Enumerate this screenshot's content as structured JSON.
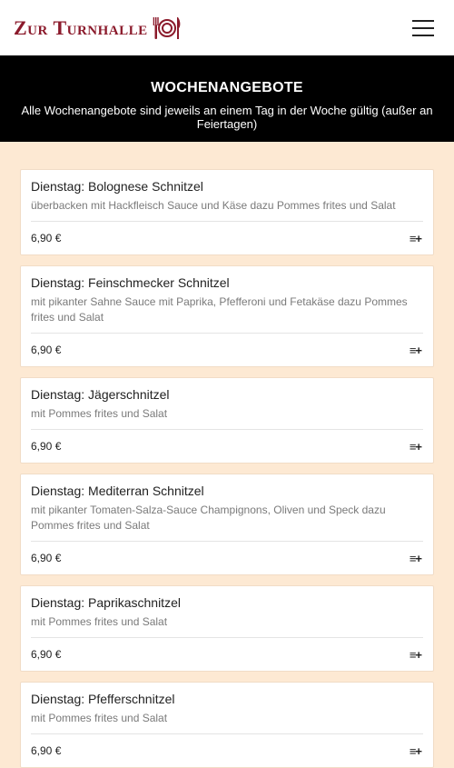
{
  "header": {
    "logo_text": "Zur Turnhalle",
    "logo_icon": "plate-fork-knife-icon",
    "menu_icon": "hamburger-menu-icon"
  },
  "banner": {
    "title": "WOCHENANGEBOTE",
    "subtitle": "Alle Wochenangebote sind jeweils an einem Tag in der Woche gültig (außer an Feiertagen)"
  },
  "colors": {
    "brand": "#8b1a2b",
    "page_bg": "#fde9d3",
    "banner_bg": "#000000"
  },
  "items": [
    {
      "title": "Dienstag: Bolognese Schnitzel",
      "desc": "überbacken mit Hackfleisch Sauce und Käse dazu Pommes frites und Salat",
      "price": "6,90 €",
      "action": "≡+"
    },
    {
      "title": "Dienstag: Feinschmecker Schnitzel",
      "desc": "mit pikanter Sahne Sauce mit Paprika, Pfefferoni und Fetakäse dazu Pommes frites und Salat",
      "price": "6,90 €",
      "action": "≡+"
    },
    {
      "title": "Dienstag: Jägerschnitzel",
      "desc": "mit Pommes frites und Salat",
      "price": "6,90 €",
      "action": "≡+"
    },
    {
      "title": "Dienstag: Mediterran Schnitzel",
      "desc": "mit pikanter Tomaten-Salza-Sauce Champignons, Oliven und Speck dazu Pommes frites und Salat",
      "price": "6,90 €",
      "action": "≡+"
    },
    {
      "title": "Dienstag: Paprikaschnitzel",
      "desc": "mit Pommes frites und Salat",
      "price": "6,90 €",
      "action": "≡+"
    },
    {
      "title": "Dienstag: Pfefferschnitzel",
      "desc": "mit Pommes frites und Salat",
      "price": "6,90 €",
      "action": "≡+"
    }
  ]
}
